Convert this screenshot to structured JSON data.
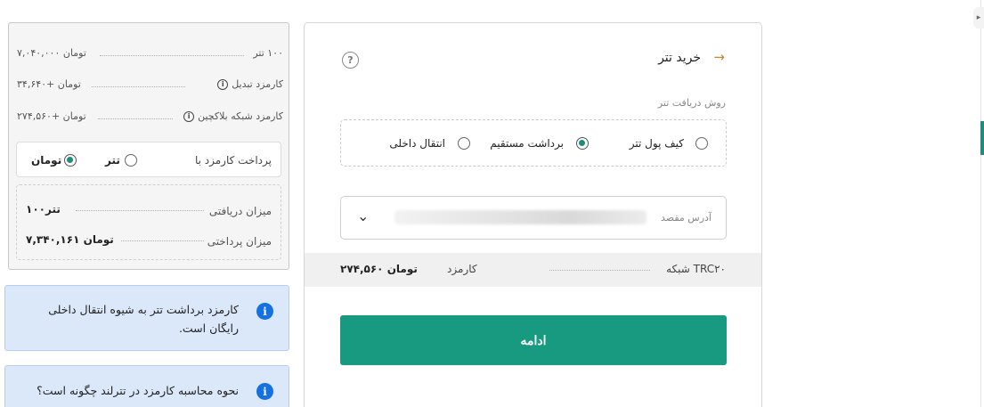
{
  "summary": {
    "rows": [
      {
        "label": "۱۰۰ تتر",
        "value": "۷,۰۴۰,۰۰۰ تومان"
      },
      {
        "label": "کارمزد تبدیل",
        "value": "۳۴,۶۴۰+ تومان"
      },
      {
        "label": "کارمزد شبکه بلاکچین",
        "value": "۲۷۴,۵۶۰+ تومان"
      }
    ],
    "fee_pay_label": "پرداخت کارمزد با",
    "fee_options": [
      {
        "label": "تتر",
        "selected": false
      },
      {
        "label": "تومان",
        "selected": true
      }
    ],
    "received_label": "میزان دریافتی",
    "received_value": "۱۰۰تتر",
    "payment_label": "میزان پرداختی",
    "payment_value": "۷,۳۴۰,۱۶۱ تومان"
  },
  "info_boxes": [
    {
      "text": "کارمزد برداشت تتر به شیوه انتقال داخلی رایگان است."
    },
    {
      "text": "نحوه محاسبه کارمزد در تترلند چگونه است؟"
    }
  ],
  "form": {
    "title": "خرید تتر",
    "method_title": "روش دریافت تتر",
    "methods": [
      {
        "label": "کیف پول تتر",
        "selected": false
      },
      {
        "label": "برداشت مستقیم",
        "selected": true
      },
      {
        "label": "انتقال داخلی",
        "selected": false
      }
    ],
    "address_placeholder": "آدرس مقصد",
    "network": "شبکه TRC۲۰",
    "fee_label": "کارمزد",
    "fee_value": "۲۷۴,۵۶۰ تومان",
    "continue_label": "ادامه"
  },
  "colors": {
    "accent": "#179a80",
    "info_bg": "#dbe8fa",
    "info_icon": "#1570e0"
  }
}
